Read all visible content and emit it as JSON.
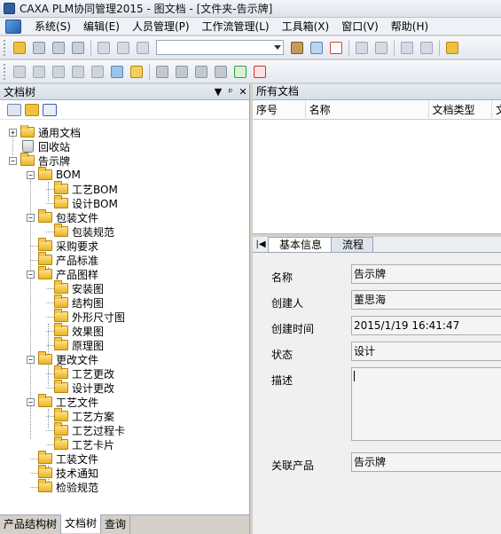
{
  "window": {
    "title": "CAXA PLM协同管理2015 - 图文档 - [文件夹-告示牌]"
  },
  "menu": [
    "系统(S)",
    "编辑(E)",
    "人员管理(P)",
    "工作流管理(L)",
    "工具箱(X)",
    "窗口(V)",
    "帮助(H)"
  ],
  "toolbar1": {
    "search_combo_value": ""
  },
  "left_panel": {
    "title": "文档树",
    "controls": {
      "dropdown": "▼",
      "pin": "ᵖ",
      "close": "✕"
    },
    "tree": [
      {
        "label": "通用文档",
        "expander": "+"
      },
      {
        "label": "回收站",
        "expander": ""
      },
      {
        "label": "告示牌",
        "expander": "−"
      },
      {
        "label": "BOM",
        "expander": "−"
      },
      {
        "label": "工艺BOM",
        "expander": ""
      },
      {
        "label": "设计BOM",
        "expander": ""
      },
      {
        "label": "包装文件",
        "expander": "−"
      },
      {
        "label": "包装规范",
        "expander": ""
      },
      {
        "label": "采购要求",
        "expander": ""
      },
      {
        "label": "产品标准",
        "expander": ""
      },
      {
        "label": "产品图样",
        "expander": "−"
      },
      {
        "label": "安装图",
        "expander": ""
      },
      {
        "label": "结构图",
        "expander": ""
      },
      {
        "label": "外形尺寸图",
        "expander": ""
      },
      {
        "label": "效果图",
        "expander": ""
      },
      {
        "label": "原理图",
        "expander": ""
      },
      {
        "label": "更改文件",
        "expander": "−"
      },
      {
        "label": "工艺更改",
        "expander": ""
      },
      {
        "label": "设计更改",
        "expander": ""
      },
      {
        "label": "工艺文件",
        "expander": "−"
      },
      {
        "label": "工艺方案",
        "expander": ""
      },
      {
        "label": "工艺过程卡",
        "expander": ""
      },
      {
        "label": "工艺卡片",
        "expander": ""
      },
      {
        "label": "工装文件",
        "expander": ""
      },
      {
        "label": "技术通知",
        "expander": ""
      },
      {
        "label": "检验规范",
        "expander": ""
      }
    ],
    "bottom_tabs": [
      "产品结构树",
      "文档树",
      "查询"
    ],
    "active_bottom_tab": "文档树"
  },
  "right_panel": {
    "title": "所有文档",
    "columns": [
      "序号",
      "名称",
      "文档类型",
      "文"
    ],
    "detail_nav": "|◀",
    "detail_tabs": [
      "基本信息",
      "流程"
    ],
    "fields": {
      "name": {
        "label": "名称",
        "value": "告示牌"
      },
      "creator": {
        "label": "创建人",
        "value": "董思海"
      },
      "created": {
        "label": "创建时间",
        "value": "2015/1/19 16:41:47"
      },
      "status": {
        "label": "状态",
        "value": "设计"
      },
      "description": {
        "label": "描述",
        "value": ""
      },
      "product": {
        "label": "关联产品",
        "value": "告示牌"
      }
    }
  },
  "colors": {
    "folder": "#e9b526",
    "accent": "#2a5fa8"
  }
}
